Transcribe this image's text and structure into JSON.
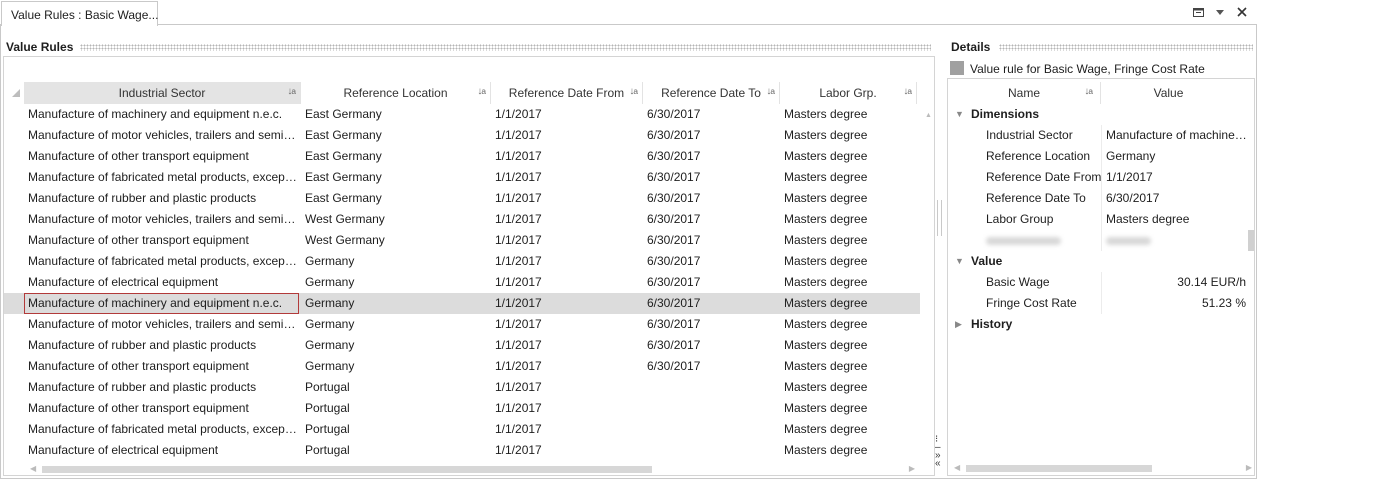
{
  "tab": {
    "title": "Value Rules : Basic Wage..."
  },
  "window": {
    "menu_icon": "window-menu-icon",
    "dropdown_icon": "chevron-down-icon",
    "close_icon": "close-icon"
  },
  "value_rules": {
    "title": "Value Rules",
    "columns": [
      "Industrial Sector",
      "Reference Location",
      "Reference Date From",
      "Reference Date To",
      "Labor Grp."
    ],
    "rows": [
      [
        "Manufacture of machinery and equipment n.e.c.",
        "East Germany",
        "1/1/2017",
        "6/30/2017",
        "Masters degree"
      ],
      [
        "Manufacture of motor vehicles, trailers and semi-trailers",
        "East Germany",
        "1/1/2017",
        "6/30/2017",
        "Masters degree"
      ],
      [
        "Manufacture of other transport equipment",
        "East Germany",
        "1/1/2017",
        "6/30/2017",
        "Masters degree"
      ],
      [
        "Manufacture of fabricated metal products, except machinery",
        "East Germany",
        "1/1/2017",
        "6/30/2017",
        "Masters degree"
      ],
      [
        "Manufacture of rubber and plastic products",
        "East Germany",
        "1/1/2017",
        "6/30/2017",
        "Masters degree"
      ],
      [
        "Manufacture of motor vehicles, trailers and semi-trailers",
        "West Germany",
        "1/1/2017",
        "6/30/2017",
        "Masters degree"
      ],
      [
        "Manufacture of other transport equipment",
        "West Germany",
        "1/1/2017",
        "6/30/2017",
        "Masters degree"
      ],
      [
        "Manufacture of fabricated metal products, except machinery",
        "Germany",
        "1/1/2017",
        "6/30/2017",
        "Masters degree"
      ],
      [
        "Manufacture of electrical equipment",
        "Germany",
        "1/1/2017",
        "6/30/2017",
        "Masters degree"
      ],
      [
        "Manufacture of machinery and equipment n.e.c.",
        "Germany",
        "1/1/2017",
        "6/30/2017",
        "Masters degree"
      ],
      [
        "Manufacture of motor vehicles, trailers and semi-trailers",
        "Germany",
        "1/1/2017",
        "6/30/2017",
        "Masters degree"
      ],
      [
        "Manufacture of rubber and plastic products",
        "Germany",
        "1/1/2017",
        "6/30/2017",
        "Masters degree"
      ],
      [
        "Manufacture of other transport equipment",
        "Germany",
        "1/1/2017",
        "6/30/2017",
        "Masters degree"
      ],
      [
        "Manufacture of rubber and plastic products",
        "Portugal",
        "1/1/2017",
        "",
        "Masters degree"
      ],
      [
        "Manufacture of other transport equipment",
        "Portugal",
        "1/1/2017",
        "",
        "Masters degree"
      ],
      [
        "Manufacture of fabricated metal products, except machinery",
        "Portugal",
        "1/1/2017",
        "",
        "Masters degree"
      ],
      [
        "Manufacture of electrical equipment",
        "Portugal",
        "1/1/2017",
        "",
        "Masters degree"
      ]
    ],
    "selected_row": 9
  },
  "details": {
    "title": "Details",
    "subtitle": "Value rule for Basic Wage, Fringe Cost Rate",
    "columns": [
      "Name",
      "Value"
    ],
    "groups": {
      "dimensions": "Dimensions",
      "value": "Value",
      "history": "History"
    },
    "dimensions": [
      {
        "name": "Industrial Sector",
        "value": "Manufacture of machinery and equipment n.e.c."
      },
      {
        "name": "Reference Location",
        "value": "Germany"
      },
      {
        "name": "Reference Date From",
        "value": "1/1/2017"
      },
      {
        "name": "Reference Date To",
        "value": "6/30/2017"
      },
      {
        "name": "Labor Group",
        "value": "Masters degree"
      }
    ],
    "values": [
      {
        "name": "Basic Wage",
        "value": "30.14 EUR/h"
      },
      {
        "name": "Fringe Cost Rate",
        "value": "51.23 %"
      }
    ]
  }
}
